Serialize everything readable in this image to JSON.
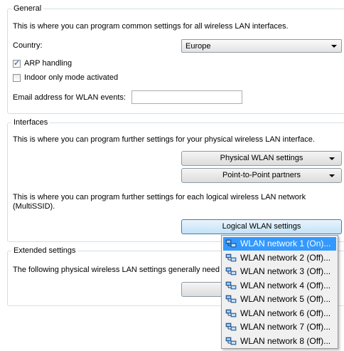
{
  "general": {
    "title": "General",
    "description": "This is where you can program common settings for all wireless LAN interfaces.",
    "country_label": "Country:",
    "country_value": "Europe",
    "arp_label": "ARP handling",
    "arp_checked": true,
    "indoor_label": "Indoor only mode activated",
    "indoor_checked": false,
    "email_label": "Email address for WLAN events:",
    "email_value": ""
  },
  "interfaces": {
    "title": "Interfaces",
    "description": "This is where you can program further settings for your physical wireless LAN interface.",
    "physical_button": "Physical WLAN settings",
    "p2p_button": "Point-to-Point partners",
    "logical_description_1": "This is where you can program further settings for each logical wireless LAN network",
    "logical_description_2": "(MultiSSID).",
    "logical_button": "Logical WLAN settings"
  },
  "extended": {
    "title": "Extended settings",
    "description": "The following physical wireless LAN settings generally need r"
  },
  "dropdown": {
    "items": [
      {
        "label": "WLAN network 1 (On)...",
        "icon": "wlan-network-icon",
        "highlighted": true
      },
      {
        "label": "WLAN network 2 (Off)...",
        "icon": "wlan-network-icon",
        "highlighted": false
      },
      {
        "label": "WLAN network 3 (Off)...",
        "icon": "wlan-network-icon",
        "highlighted": false
      },
      {
        "label": "WLAN network 4 (Off)...",
        "icon": "wlan-network-icon",
        "highlighted": false
      },
      {
        "label": "WLAN network 5 (Off)...",
        "icon": "wlan-network-icon",
        "highlighted": false
      },
      {
        "label": "WLAN network 6 (Off)...",
        "icon": "wlan-network-icon",
        "highlighted": false
      },
      {
        "label": "WLAN network 7 (Off)...",
        "icon": "wlan-network-icon",
        "highlighted": false
      },
      {
        "label": "WLAN network 8 (Off)...",
        "icon": "wlan-network-icon",
        "highlighted": false
      }
    ]
  },
  "colors": {
    "highlight": "#3399ff",
    "group_border": "#d5dfe5"
  }
}
